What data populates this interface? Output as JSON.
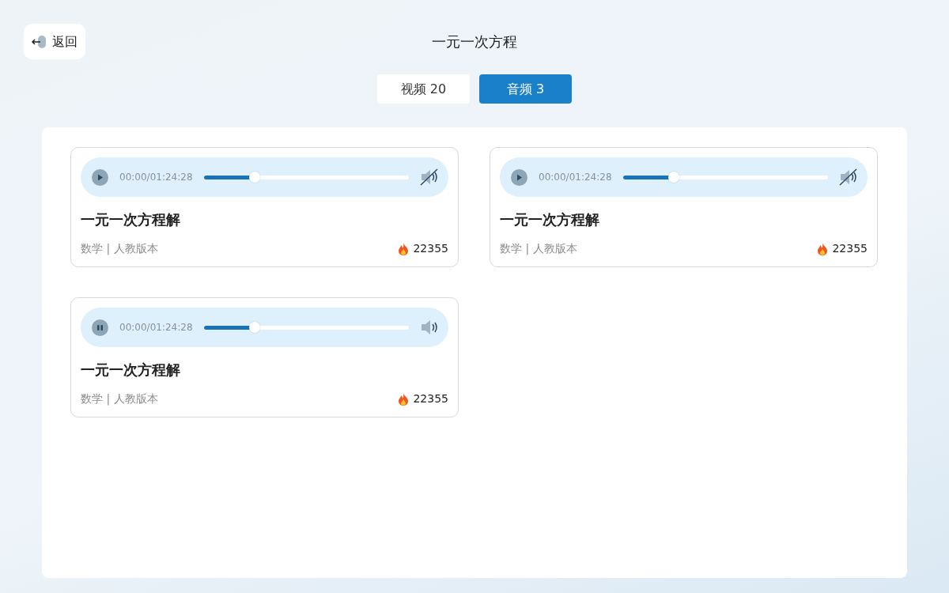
{
  "back_button": {
    "label": "返回"
  },
  "title": "一元一次方程",
  "tabs": [
    {
      "label": "视频 20",
      "selected": false
    },
    {
      "label": "音频 3",
      "selected": true
    }
  ],
  "audio_items": [
    {
      "playing": false,
      "time": "00:00/01:24:28",
      "level": 0.25,
      "muted": true,
      "title": "一元一次方程解",
      "meta": "数学 | 人教版本",
      "views": "22355"
    },
    {
      "playing": false,
      "time": "00:00/01:24:28",
      "level": 0.25,
      "muted": true,
      "title": "一元一次方程解",
      "meta": "数学 | 人教版本",
      "views": "22355"
    },
    {
      "playing": true,
      "time": "00:00/01:24:28",
      "level": 0.25,
      "muted": false,
      "title": "一元一次方程解",
      "meta": "数学 | 人教版本",
      "views": "22355"
    }
  ]
}
